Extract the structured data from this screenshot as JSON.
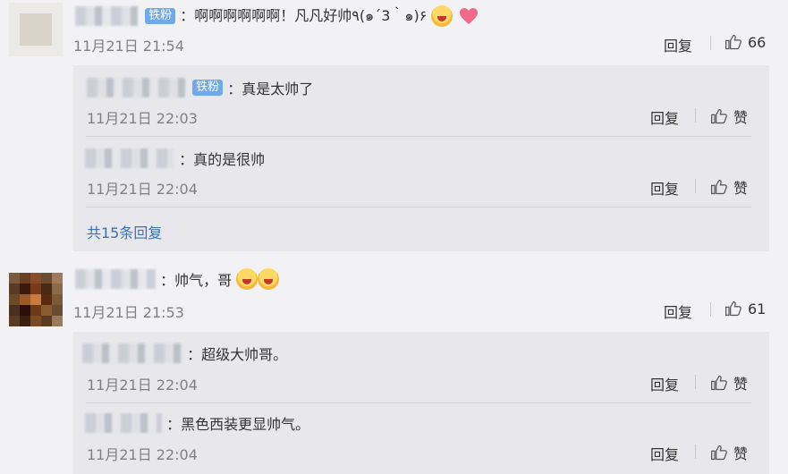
{
  "comments": [
    {
      "badge": "铁粉",
      "text": "：啊啊啊啊啊啊！凡凡好帅٩(๑´3｀๑)۶",
      "time": "11月21日 21:54",
      "reply_label": "回复",
      "like_count": "66",
      "replies": [
        {
          "badge": "铁粉",
          "text": "：真是太帅了",
          "time": "11月21日 22:03",
          "reply_label": "回复",
          "like_label": "赞"
        },
        {
          "badge": "",
          "text": "：真的是很帅",
          "time": "11月21日 22:04",
          "reply_label": "回复",
          "like_label": "赞"
        }
      ],
      "more_replies": "共15条回复"
    },
    {
      "badge": "",
      "text": "：帅气，哥",
      "time": "11月21日 21:53",
      "reply_label": "回复",
      "like_count": "61",
      "replies": [
        {
          "badge": "",
          "text": "：超级大帅哥。",
          "time": "11月21日 22:04",
          "reply_label": "回复",
          "like_label": "赞"
        },
        {
          "badge": "",
          "text": "：黑色西装更显帅气。",
          "time": "11月21日 22:04",
          "reply_label": "回复",
          "like_label": "赞"
        }
      ]
    }
  ],
  "colors": {
    "background": "#f2f2f5",
    "sub_background": "#e8e8ec",
    "badge": "#6fa9e8",
    "link": "#3d6fb1",
    "time": "#808080"
  }
}
